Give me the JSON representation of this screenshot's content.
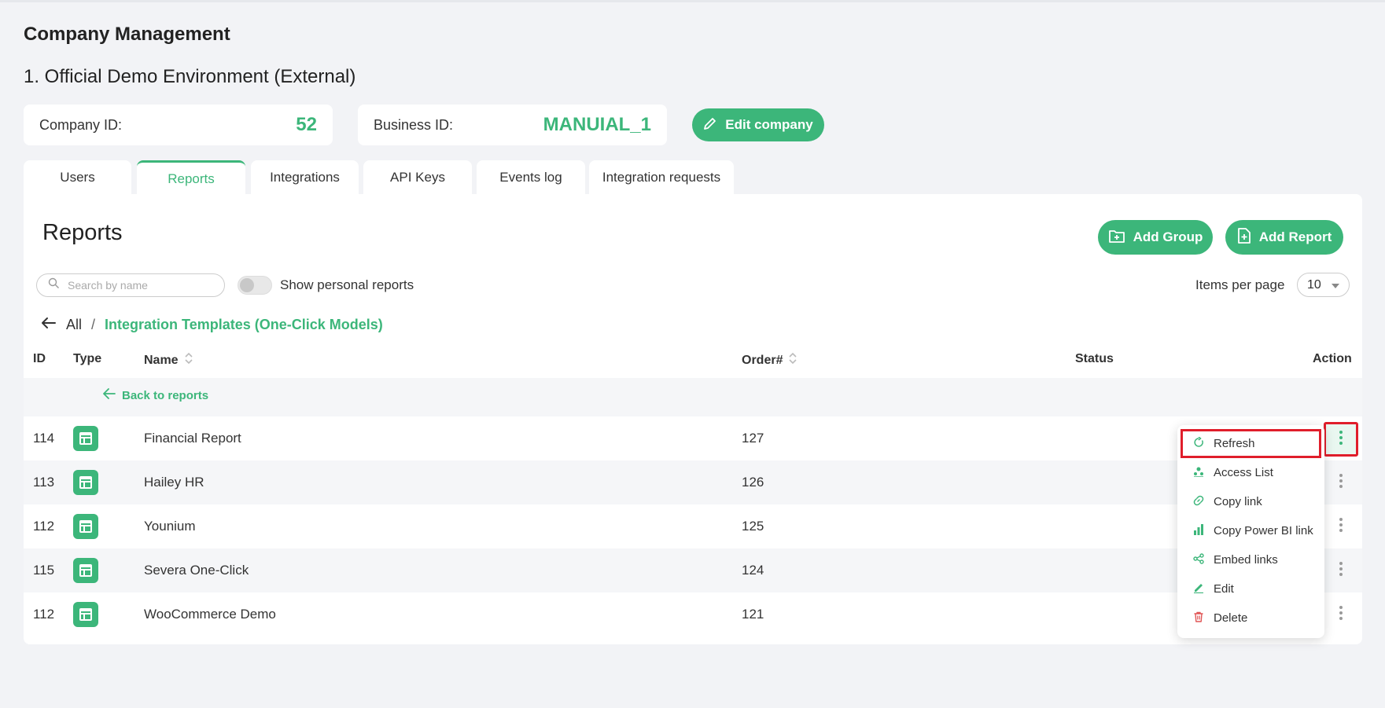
{
  "header": {
    "title": "Company Management",
    "company_name": "1. Official Demo Environment (External)"
  },
  "company_info": {
    "company_id_label": "Company ID:",
    "company_id_value": "52",
    "business_id_label": "Business ID:",
    "business_id_value": "MANUIAL_1",
    "edit_label": "Edit company"
  },
  "tabs": [
    {
      "label": "Users",
      "active": false
    },
    {
      "label": "Reports",
      "active": true
    },
    {
      "label": "Integrations",
      "active": false
    },
    {
      "label": "API Keys",
      "active": false
    },
    {
      "label": "Events log",
      "active": false
    },
    {
      "label": "Integration requests",
      "active": false
    }
  ],
  "reports": {
    "title": "Reports",
    "add_group_label": "Add Group",
    "add_report_label": "Add Report",
    "search_placeholder": "Search by name",
    "show_personal_label": "Show personal reports",
    "show_personal_on": false,
    "items_per_page_label": "Items per page",
    "items_per_page_value": "10"
  },
  "breadcrumb": {
    "root": "All",
    "separator": "/",
    "current": "Integration Templates (One-Click Models)"
  },
  "table": {
    "columns": {
      "id": "ID",
      "type": "Type",
      "name": "Name",
      "order": "Order#",
      "status": "Status",
      "action": "Action"
    },
    "back_label": "Back to reports",
    "rows": [
      {
        "id": "114",
        "name": "Financial Report",
        "order": "127",
        "status": ""
      },
      {
        "id": "113",
        "name": "Hailey HR",
        "order": "126",
        "status": ""
      },
      {
        "id": "112",
        "name": "Younium",
        "order": "125",
        "status": ""
      },
      {
        "id": "115",
        "name": "Severa One-Click",
        "order": "124",
        "status": ""
      },
      {
        "id": "112",
        "name": "WooCommerce Demo",
        "order": "121",
        "status": ""
      }
    ]
  },
  "action_menu": {
    "items": [
      {
        "label": "Refresh",
        "icon": "refresh-icon"
      },
      {
        "label": "Access List",
        "icon": "users-icon"
      },
      {
        "label": "Copy link",
        "icon": "link-icon"
      },
      {
        "label": "Copy Power BI link",
        "icon": "powerbi-icon"
      },
      {
        "label": "Embed links",
        "icon": "share-icon"
      },
      {
        "label": "Edit",
        "icon": "pencil-icon"
      },
      {
        "label": "Delete",
        "icon": "trash-icon"
      }
    ]
  },
  "colors": {
    "accent": "#3cb67a",
    "danger": "#e05555",
    "highlight": "#e01e2b"
  }
}
